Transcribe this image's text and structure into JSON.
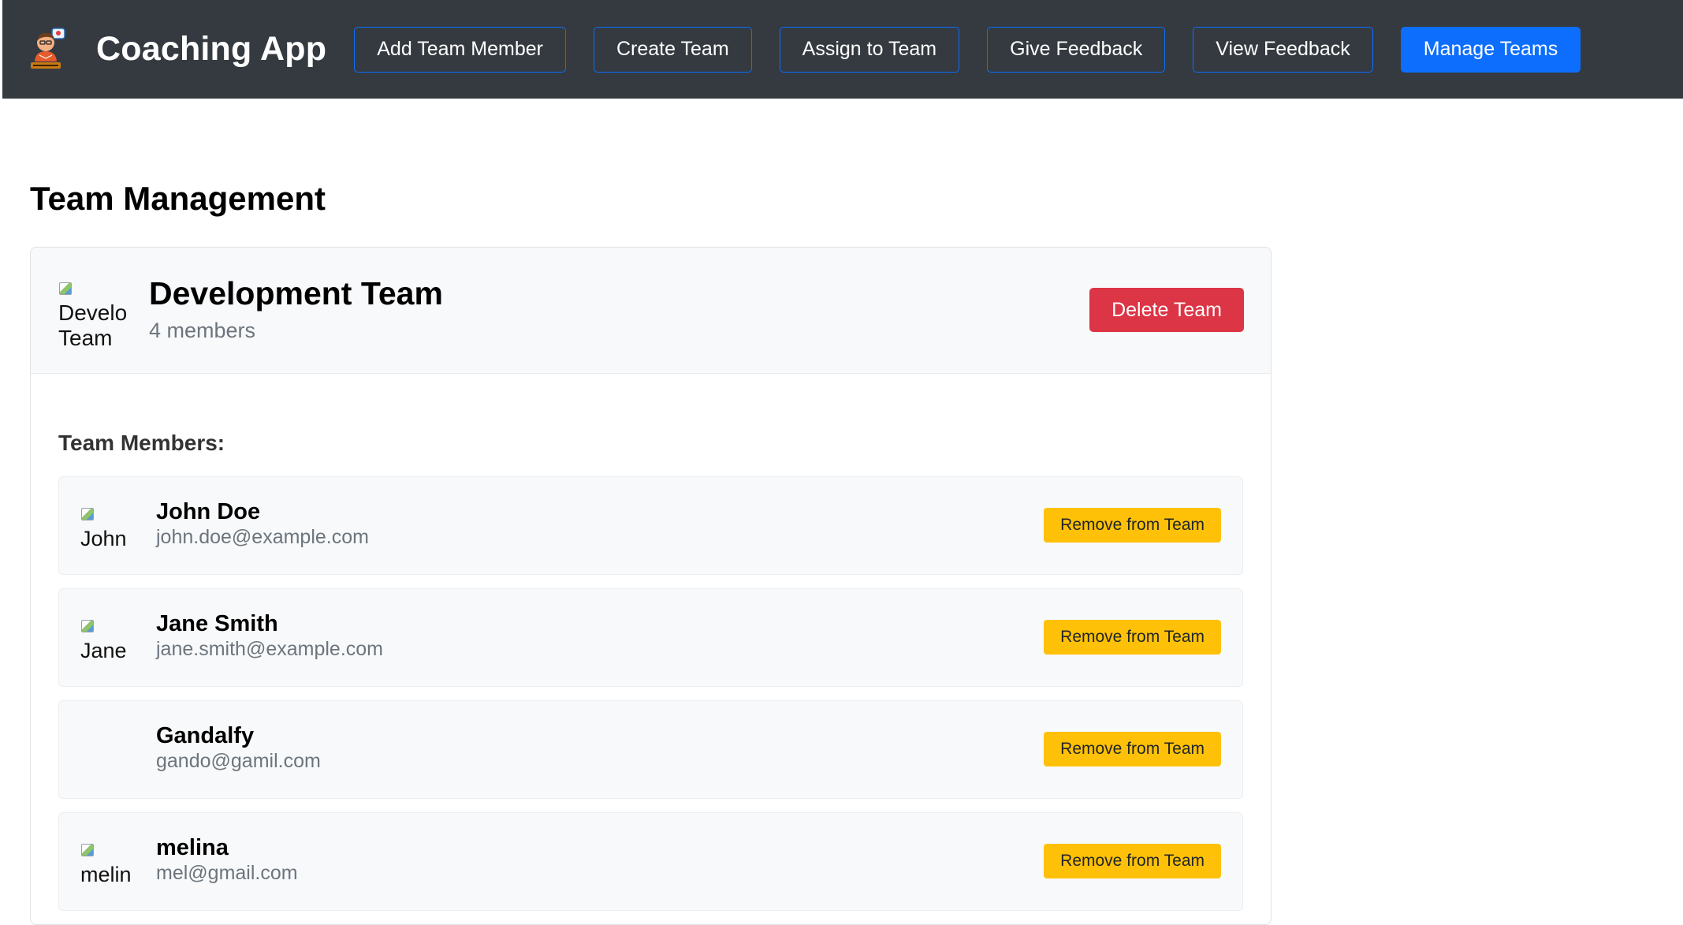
{
  "app": {
    "title": "Coaching App",
    "logo_icon": "coach-mascot-icon"
  },
  "nav": {
    "buttons": [
      {
        "label": "Add Team Member",
        "active": false
      },
      {
        "label": "Create Team",
        "active": false
      },
      {
        "label": "Assign to Team",
        "active": false
      },
      {
        "label": "Give Feedback",
        "active": false
      },
      {
        "label": "View Feedback",
        "active": false
      },
      {
        "label": "Manage Teams",
        "active": true
      }
    ]
  },
  "page": {
    "title": "Team Management"
  },
  "team": {
    "image_alt": "Develo Team",
    "name": "Development Team",
    "member_count": "4 members",
    "delete_label": "Delete Team",
    "members_heading": "Team Members:",
    "members": [
      {
        "name": "John Doe",
        "email": "john.doe@example.com",
        "image_alt": "John",
        "remove_label": "Remove from Team"
      },
      {
        "name": "Jane Smith",
        "email": "jane.smith@example.com",
        "image_alt": "Jane",
        "remove_label": "Remove from Team"
      },
      {
        "name": "Gandalfy",
        "email": "gando@gamil.com",
        "image_alt": "",
        "remove_label": "Remove from Team"
      },
      {
        "name": "melina",
        "email": "mel@gmail.com",
        "image_alt": "melin",
        "remove_label": "Remove from Team"
      }
    ]
  },
  "colors": {
    "navbar": "#343a40",
    "primary": "#0d6efd",
    "danger": "#dc3545",
    "warning": "#ffc107"
  }
}
